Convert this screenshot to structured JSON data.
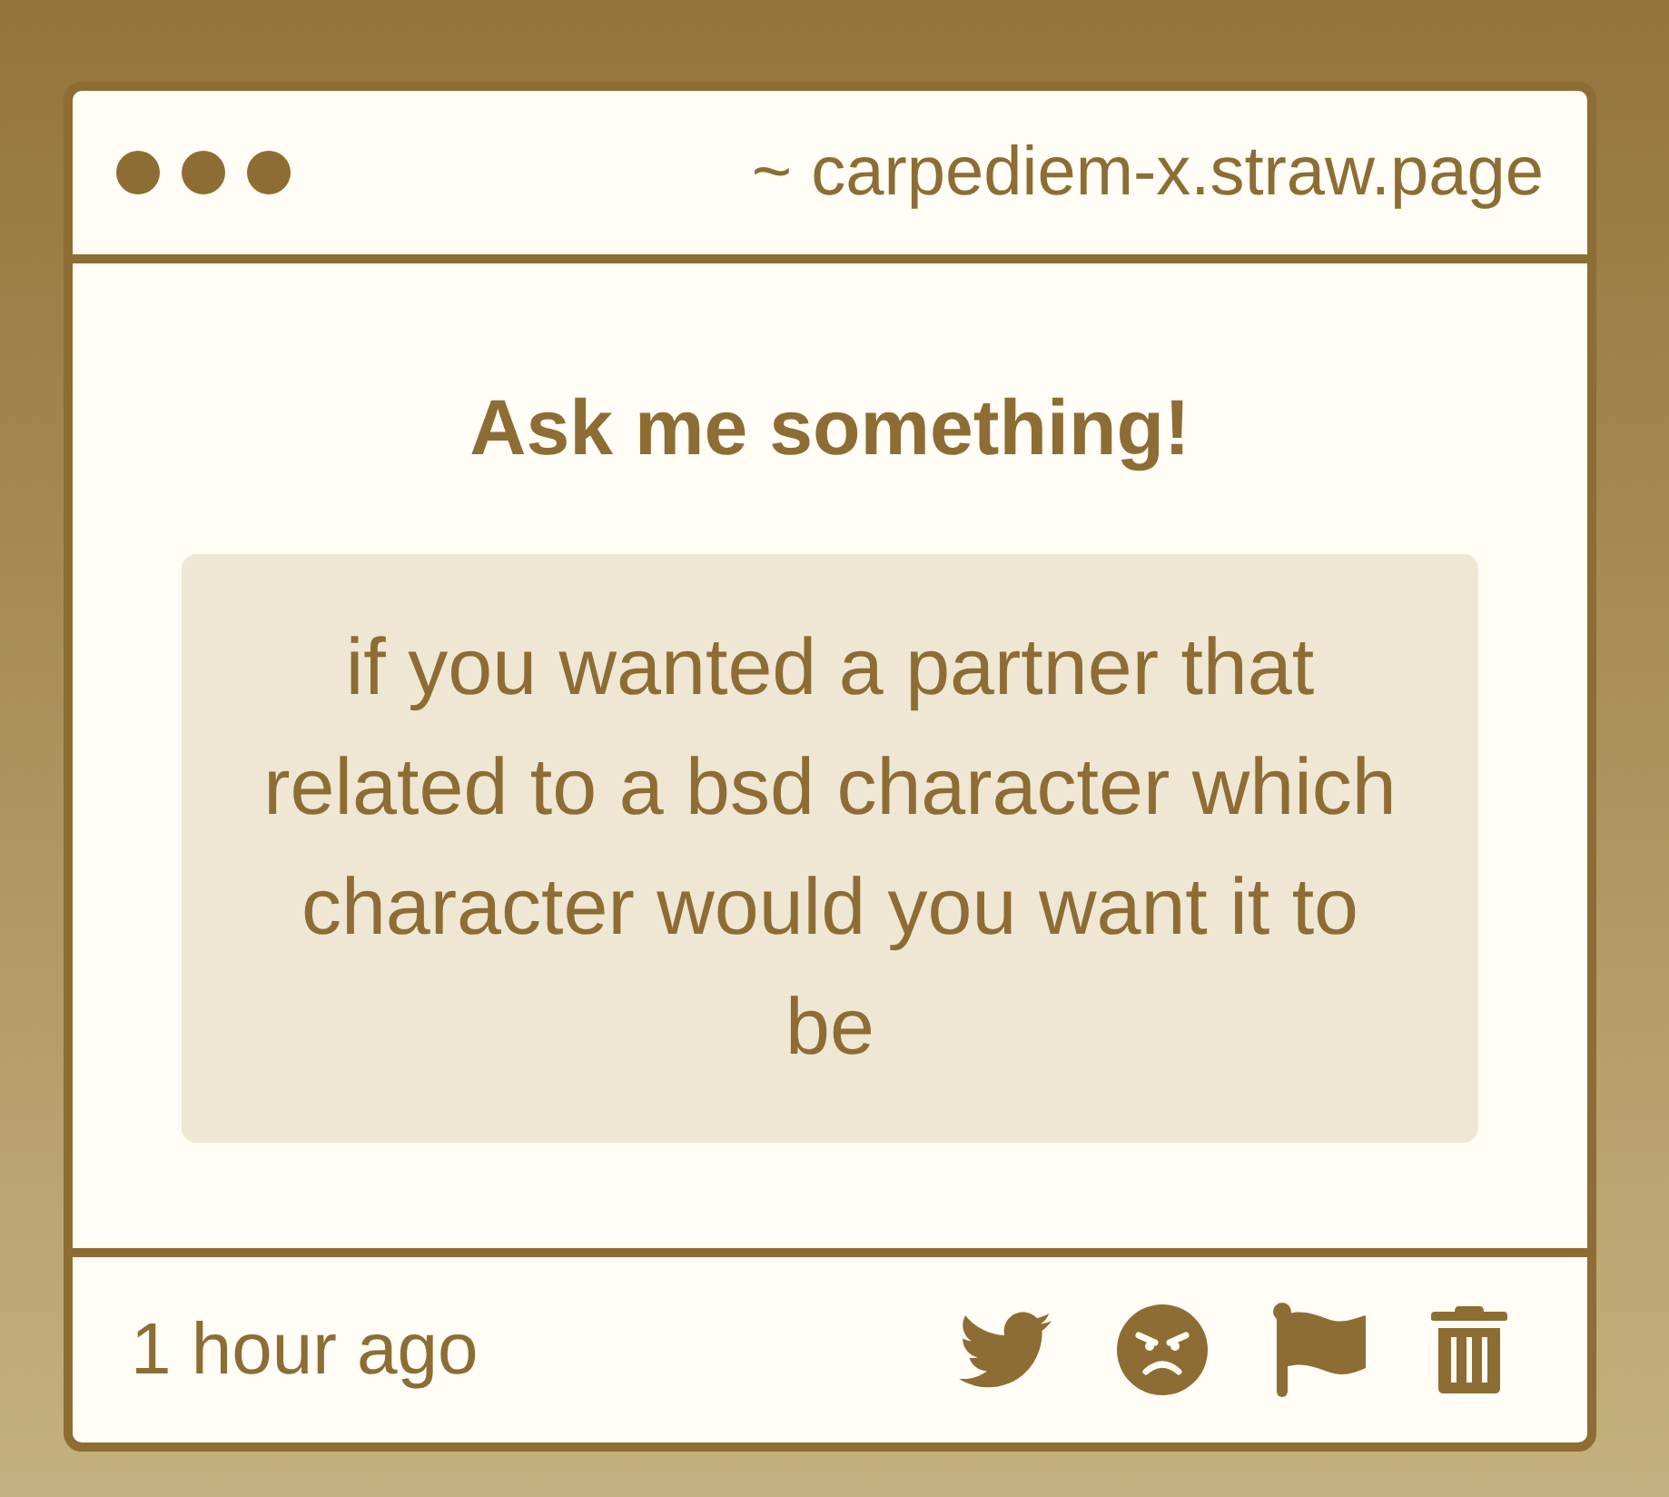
{
  "window": {
    "url": "~ carpediem-x.straw.page"
  },
  "prompt": {
    "title": "Ask me something!"
  },
  "question": {
    "text": "if you wanted a partner that related to a bsd character which character would you want it to be"
  },
  "footer": {
    "time": "1 hour ago"
  }
}
